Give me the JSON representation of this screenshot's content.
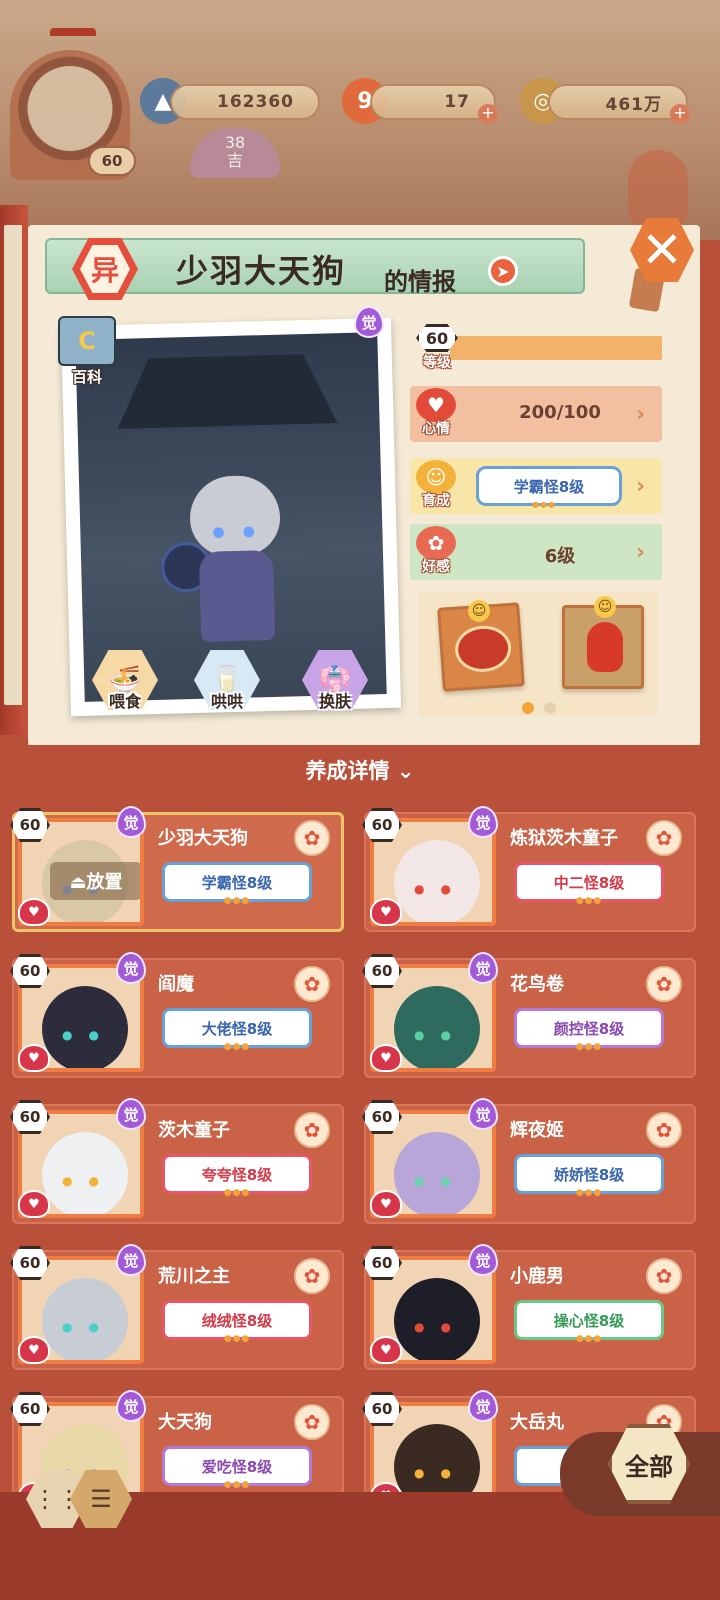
{
  "top": {
    "resources": [
      {
        "icon": "mountain-icon",
        "value": "162360"
      },
      {
        "icon": "magatama-icon",
        "value": "17"
      },
      {
        "icon": "coin-icon",
        "value": "461万"
      }
    ],
    "player_level": "60",
    "day_count": "38",
    "day_label": "吉"
  },
  "info": {
    "category_char": "异",
    "name": "少羽大天狗",
    "name_suffix": "的情报",
    "encyclopedia_label": "百科",
    "awaken_char": "觉",
    "level_value": "60",
    "level_label": "等级",
    "mood_label": "心情",
    "mood_value": "200/100",
    "growth_label": "育成",
    "growth_title": "学霸怪8级",
    "affection_label": "好感",
    "affection_value": "6级",
    "actions": [
      {
        "label": "喂食",
        "icon": "noodle-icon"
      },
      {
        "label": "哄哄",
        "icon": "milk-icon"
      },
      {
        "label": "换肤",
        "icon": "wardrobe-icon"
      }
    ]
  },
  "detail_header": "养成详情",
  "place_label": "放置",
  "cards": [
    {
      "name": "少羽大天狗",
      "level": "60",
      "tag": "学霸怪8级",
      "tag_color": "#3a66b0",
      "tag_border": "#6aa0d8",
      "face": "#d9c8a6",
      "eye": "#8ab8ff",
      "active": true
    },
    {
      "name": "炼狱茨木童子",
      "level": "60",
      "tag": "中二怪8级",
      "tag_color": "#d23c4a",
      "tag_border": "#e8566a",
      "face": "#f3e6e6",
      "eye": "#e24a3a",
      "active": false
    },
    {
      "name": "阎魔",
      "level": "60",
      "tag": "大佬怪8级",
      "tag_color": "#3a66b0",
      "tag_border": "#6aa0d8",
      "face": "#2c2c3c",
      "eye": "#4ad0c8",
      "active": false
    },
    {
      "name": "花鸟卷",
      "level": "60",
      "tag": "颜控怪8级",
      "tag_color": "#8a4ab0",
      "tag_border": "#b07ad8",
      "face": "#2e6a5e",
      "eye": "#5ad0a0",
      "active": false
    },
    {
      "name": "茨木童子",
      "level": "60",
      "tag": "夸夸怪8级",
      "tag_color": "#d23c4a",
      "tag_border": "#e8566a",
      "face": "#eef0f2",
      "eye": "#f3b23a",
      "active": false
    },
    {
      "name": "辉夜姬",
      "level": "60",
      "tag": "娇娇怪8级",
      "tag_color": "#3a66b0",
      "tag_border": "#6aa0d8",
      "face": "#b8a6d8",
      "eye": "#6ad0b0",
      "active": false
    },
    {
      "name": "荒川之主",
      "level": "60",
      "tag": "绒绒怪8级",
      "tag_color": "#d23c4a",
      "tag_border": "#e8566a",
      "face": "#c8ccd4",
      "eye": "#4ad0c8",
      "active": false
    },
    {
      "name": "小鹿男",
      "level": "60",
      "tag": "操心怪8级",
      "tag_color": "#3a9a5a",
      "tag_border": "#6ac88a",
      "face": "#1e1e28",
      "eye": "#e24a3a",
      "active": false
    },
    {
      "name": "大天狗",
      "level": "60",
      "tag": "爱吃怪8级",
      "tag_color": "#8a4ab0",
      "tag_border": "#b07ad8",
      "face": "#e8d8a8",
      "eye": "#6aa0ff",
      "active": false
    },
    {
      "name": "大岳丸",
      "level": "60",
      "tag": "",
      "tag_color": "#3a66b0",
      "tag_border": "#6aa0d8",
      "face": "#3a2a22",
      "eye": "#f3b23a",
      "active": false
    }
  ],
  "all_button": "全部",
  "colors": {
    "accent_red": "#b8503a",
    "paper": "#f4ead6",
    "ribbon_green": "#a9d2b3"
  }
}
